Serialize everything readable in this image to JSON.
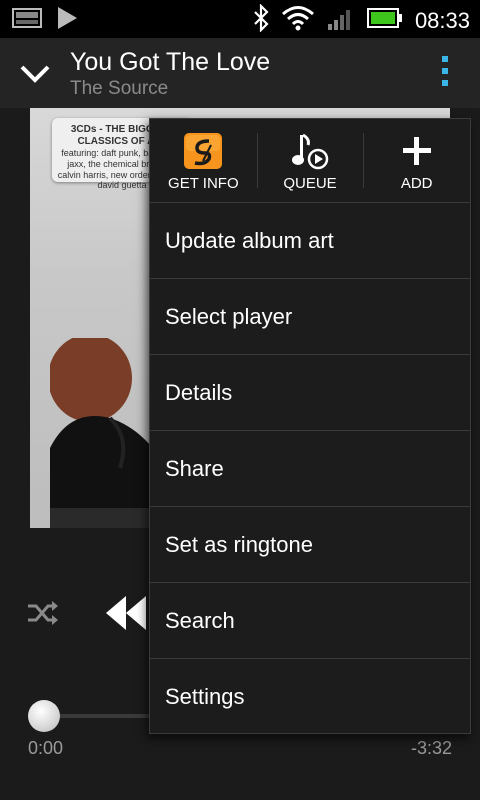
{
  "status_bar": {
    "time": "08:33",
    "icons": [
      "picture-icon",
      "play-icon",
      "bluetooth-icon",
      "wifi-icon",
      "signal-icon",
      "battery-icon"
    ],
    "battery_color": "#3ec61c"
  },
  "header": {
    "title": "You Got The Love",
    "artist": "The Source",
    "overflow_color": "#39b5e8"
  },
  "album_art": {
    "label_title": "3CDs - THE BIGGEST CLASSICS OF ALL",
    "label_text": "featuring: daft punk, basement jaxx, the chemical brothers, calvin harris, new order, leftfield, david guetta"
  },
  "menu": {
    "top_actions": [
      {
        "label": "GET INFO",
        "icon": "soundhound-icon"
      },
      {
        "label": "QUEUE",
        "icon": "queue-music-icon"
      },
      {
        "label": "ADD",
        "icon": "add-icon"
      }
    ],
    "items": [
      "Update album art",
      "Select player",
      "Details",
      "Share",
      "Set as ringtone",
      "Search",
      "Settings"
    ]
  },
  "player": {
    "elapsed": "0:00",
    "remaining": "-3:32",
    "progress": 0.0
  }
}
